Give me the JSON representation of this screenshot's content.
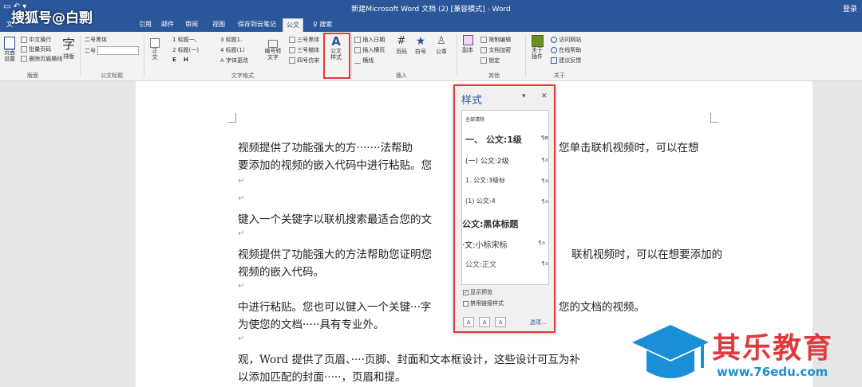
{
  "window": {
    "title": "新建Microsoft Word 文档 (2) [兼容模式] - Word",
    "login": "登录"
  },
  "watermarks": {
    "sohu": "搜狐号@白剽",
    "brand_name": "其乐教育",
    "brand_url": "www.76edu.com"
  },
  "tabs": [
    {
      "label": "文"
    },
    {
      "label": "引用"
    },
    {
      "label": "邮件"
    },
    {
      "label": "审阅"
    },
    {
      "label": "视图"
    },
    {
      "label": "保存到云笔记"
    },
    {
      "label": "公文"
    },
    {
      "label": "♀ 搜索"
    }
  ],
  "ribbon": {
    "page_group": {
      "page_setup": "页面设置",
      "chinese_break": "中文换行",
      "page_numbers": "批量页码",
      "remove_lines": "删除页眉横线",
      "big_char": "字",
      "typeset": "排版",
      "label": "版面"
    },
    "doc_title_group": {
      "font_2_label": "二号黑体",
      "size_2_label": "二号",
      "label": "公文标题"
    },
    "text_format_group": {
      "body": "正文",
      "heading1": "1 标题一、",
      "heading2": "2 标题(一)",
      "heading_e": "E",
      "heading_h": "H",
      "heading3": "3 标题1.",
      "heading4": "4 标题(1)",
      "font_change": "字体更改",
      "numbering": "编号转文字",
      "font3_hei": "三号黑体",
      "font3_kai": "三号楷体",
      "font4_fang": "四号仿宋",
      "doc_style": "公文样式",
      "label": "文字格式"
    },
    "insert_group": {
      "insert_date": "插入日期",
      "insert_header": "插入横页",
      "lines": "横线",
      "page_no": "页码",
      "symbol": "符号",
      "seal": "公章",
      "label": "插入"
    },
    "other_group": {
      "copy": "副本",
      "limit_edit": "限制编辑",
      "doc_encrypt": "文档加密",
      "lock": "锁定",
      "label": "其他"
    },
    "about_group": {
      "about_plugin": "关于插件",
      "visit_site": "访问网站",
      "online_help": "在线帮助",
      "feedback": "建议反馈",
      "label": "关于"
    }
  },
  "document": {
    "paragraphs": [
      "视频提供了功能强大的方·······法帮助",
      "要添加的视频的嵌入代码中进行粘贴。您",
      "键入一个关键字以联机搜索最适合您的文",
      "视频提供了功能强大的方法帮助您证明您",
      "视频的嵌入代码。",
      "中进行粘贴。您也可以键入一个关键···字",
      "为使您的文档·····具有专业外。",
      "观，Word 提供了页眉、····页脚、封面和文本框设计，这些设计可互为补",
      "以添加匹配的封面·····，页眉和提。"
    ],
    "right_fragments": [
      "您单击联机视频时，可以在想",
      "联机视频时，可以在想要添加的",
      "您的文档的视频。"
    ]
  },
  "styles_pane": {
    "title": "样式",
    "clear_all": "全部清除",
    "items": [
      {
        "label": "一、 公文:1级"
      },
      {
        "label": "(一) 公文:2级"
      },
      {
        "label": "1. 公文:3级标"
      },
      {
        "label": "(1) 公文:4"
      },
      {
        "label": "公文:黑体标题"
      },
      {
        "label": "·文:小标宋标"
      },
      {
        "label": "公文:正文"
      }
    ],
    "show_preview": "显示预览",
    "disable_linked": "禁用链接样式",
    "options": "选项..."
  }
}
